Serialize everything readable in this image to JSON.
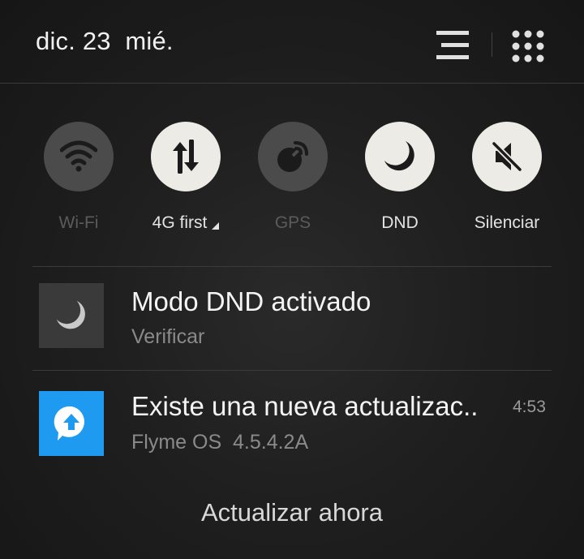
{
  "header": {
    "date": "dic. 23  mié.",
    "icons": [
      "notification-list-icon",
      "app-grid-icon"
    ]
  },
  "toggles": [
    {
      "label": "Wi-Fi",
      "icon": "wifi-icon",
      "active": false
    },
    {
      "label": "4G first",
      "icon": "data-transfer-icon",
      "active": true
    },
    {
      "label": "GPS",
      "icon": "gps-icon",
      "active": false
    },
    {
      "label": "DND",
      "icon": "moon-icon",
      "active": true
    },
    {
      "label": "Silenciar",
      "icon": "mute-icon",
      "active": true
    }
  ],
  "notifications": [
    {
      "title": "Modo DND activado",
      "subtitle": "Verificar",
      "icon": "moon-icon"
    },
    {
      "title": "Existe una nueva actualizac..",
      "subtitle": "Flyme OS  4.5.4.2A",
      "time": "4:53",
      "icon": "update-arrow-icon",
      "action_label": "Actualizar ahora"
    }
  ],
  "colors": {
    "background": "#1f1f1f",
    "toggle_on": "#ecebe6",
    "toggle_off": "#4b4b4b",
    "update_icon_bg": "#1e9af0"
  }
}
